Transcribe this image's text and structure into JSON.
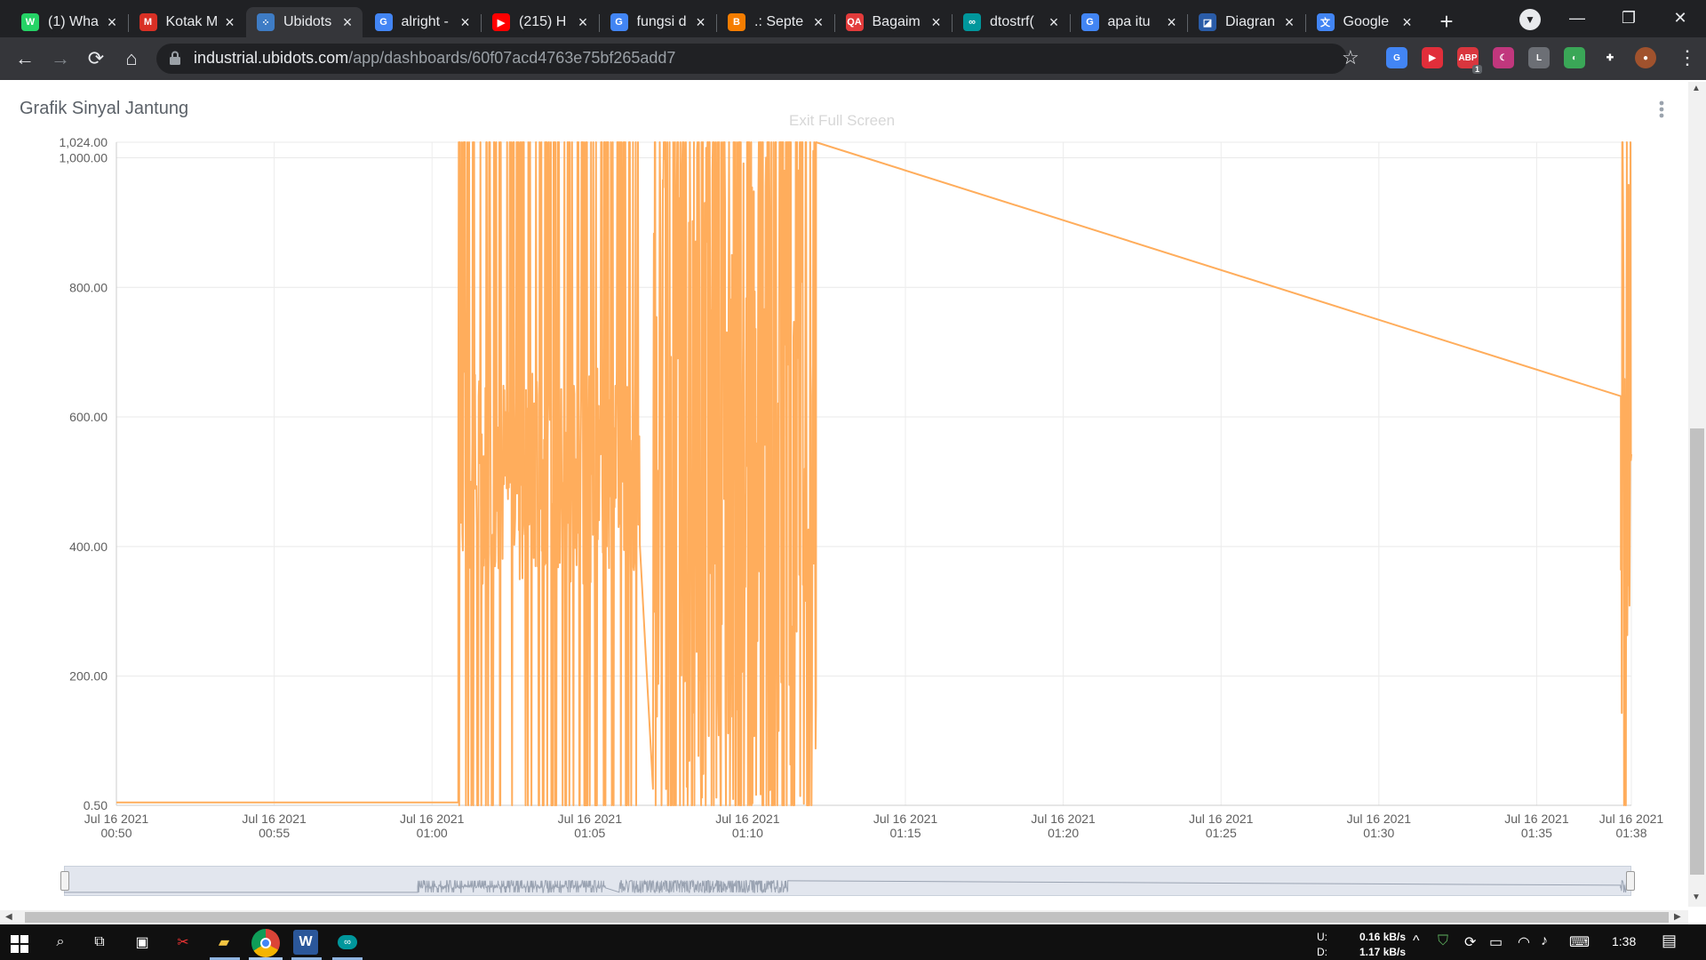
{
  "browser": {
    "tabs": [
      {
        "title": "(1) Wha",
        "icon": "whatsapp-icon",
        "color": "#25d366",
        "glyph": "W"
      },
      {
        "title": "Kotak M",
        "icon": "gmail-icon",
        "color": "#d93025",
        "glyph": "M"
      },
      {
        "title": "Ubidots",
        "icon": "ubidots-icon",
        "color": "#3e7cc5",
        "glyph": "⁘",
        "active": true
      },
      {
        "title": "alright -",
        "icon": "google-icon",
        "color": "#4285f4",
        "glyph": "G"
      },
      {
        "title": "(215) H",
        "icon": "youtube-icon",
        "color": "#ff0000",
        "glyph": "▶"
      },
      {
        "title": "fungsi d",
        "icon": "google-icon",
        "color": "#4285f4",
        "glyph": "G"
      },
      {
        "title": ".: Septe",
        "icon": "blogger-icon",
        "color": "#f57d00",
        "glyph": "B"
      },
      {
        "title": "Bagaim",
        "icon": "qa-icon",
        "color": "#e23b3b",
        "glyph": "QA"
      },
      {
        "title": "dtostrf(",
        "icon": "arduino-icon",
        "color": "#00979c",
        "glyph": "∞"
      },
      {
        "title": "apa itu",
        "icon": "google-icon",
        "color": "#4285f4",
        "glyph": "G"
      },
      {
        "title": "Diagran",
        "icon": "diagram-icon",
        "color": "#2a5ca8",
        "glyph": "◪"
      },
      {
        "title": "Google",
        "icon": "translate-icon",
        "color": "#4285f4",
        "glyph": "文"
      }
    ],
    "new_tab_label": "+",
    "url_domain": "industrial.ubidots.com",
    "url_path": "/app/dashboards/60f07acd4763e75bf265add7",
    "extensions": [
      {
        "name": "google-translate-ext-icon",
        "color": "#4285f4",
        "glyph": "G"
      },
      {
        "name": "readme-ext-icon",
        "color": "#e12e3a",
        "glyph": "▶"
      },
      {
        "name": "adblock-ext-icon",
        "color": "#d9363e",
        "glyph": "ABP",
        "badge": "1"
      },
      {
        "name": "dark-mode-ext-icon",
        "color": "#c1377d",
        "glyph": "☾"
      },
      {
        "name": "line-ext-icon",
        "color": "#6c6f75",
        "glyph": "L"
      },
      {
        "name": "colorful-ext-icon",
        "color": "#3aa757",
        "glyph": "◐"
      },
      {
        "name": "puzzle-ext-icon",
        "color": "#35363a",
        "glyph": "✚"
      },
      {
        "name": "profile-avatar",
        "color": "#a0522d",
        "glyph": "●"
      }
    ]
  },
  "dashboard": {
    "widget_title": "Grafik Sinyal Jantung",
    "exit_fullscreen_label": "Exit Full Screen"
  },
  "chart_data": {
    "type": "line",
    "title": "Grafik Sinyal Jantung",
    "series": [
      {
        "color": "#ffad5c"
      }
    ],
    "y_ticks": [
      "1,024.00",
      "1,000.00",
      "800.00",
      "600.00",
      "400.00",
      "200.00",
      "0.50"
    ],
    "y_tick_values": [
      1024,
      1000,
      800,
      600,
      400,
      200,
      0.5
    ],
    "ylim": [
      0.5,
      1024
    ],
    "x_ticks": [
      {
        "date": "Jul 16 2021",
        "time": "00:50"
      },
      {
        "date": "Jul 16 2021",
        "time": "00:55"
      },
      {
        "date": "Jul 16 2021",
        "time": "01:00"
      },
      {
        "date": "Jul 16 2021",
        "time": "01:05"
      },
      {
        "date": "Jul 16 2021",
        "time": "01:10"
      },
      {
        "date": "Jul 16 2021",
        "time": "01:15"
      },
      {
        "date": "Jul 16 2021",
        "time": "01:20"
      },
      {
        "date": "Jul 16 2021",
        "time": "01:25"
      },
      {
        "date": "Jul 16 2021",
        "time": "01:30"
      },
      {
        "date": "Jul 16 2021",
        "time": "01:35"
      },
      {
        "date": "Jul 16 2021",
        "time": "01:38"
      }
    ],
    "xlim": [
      "00:50",
      "01:38"
    ],
    "grid": true,
    "segments": [
      {
        "kind": "flat",
        "from": "00:50",
        "to": "01:00:50",
        "value": 5
      },
      {
        "kind": "noise",
        "from": "01:00:50",
        "to": "01:06:35",
        "low": 0.5,
        "high": 1024,
        "band": [
          340,
          680
        ]
      },
      {
        "kind": "noise",
        "from": "01:07:00",
        "to": "01:12:10",
        "low": 0.5,
        "high": 1024,
        "band": [
          0.5,
          1024
        ]
      },
      {
        "kind": "ramp",
        "from": "01:12:10",
        "to": "01:37:40",
        "start": 1024,
        "end": 632
      },
      {
        "kind": "noise",
        "from": "01:37:40",
        "to": "01:38:00",
        "low": 0.5,
        "high": 1024,
        "band": [
          0.5,
          1024
        ]
      }
    ]
  },
  "taskbar": {
    "upload_label": "U:",
    "download_label": "D:",
    "upload_rate": "0.16 kB/s",
    "download_rate": "1.17 kB/s",
    "clock": "1:38"
  }
}
